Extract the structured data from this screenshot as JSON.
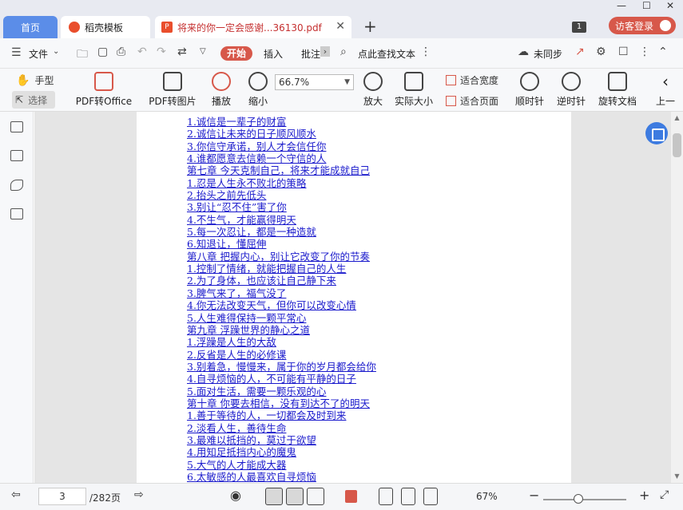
{
  "tabs": {
    "home": "首页",
    "wps": "稻壳模板",
    "pdf": "将来的你一定会感谢...36130.pdf"
  },
  "titlebar": {
    "window_count": "1",
    "login": "访客登录"
  },
  "menu": {
    "file": "文件",
    "start": "开始",
    "insert": "插入",
    "annotate": "批注",
    "search": "点此查找文本",
    "sync": "未同步"
  },
  "ribbon": {
    "hand": "手型",
    "select": "选择",
    "pdf_office": "PDF转Office",
    "pdf_image": "PDF转图片",
    "play": "播放",
    "zoom_out": "缩小",
    "zoom_value": "66.7%",
    "zoom_in": "放大",
    "actual": "实际大小",
    "fit_width": "适合宽度",
    "fit_page": "适合页面",
    "rotate_cw": "顺时针",
    "rotate_ccw": "逆时针",
    "rotate_doc": "旋转文档",
    "prev": "上一"
  },
  "document": {
    "lines": [
      "1.诚信是一辈子的财富",
      "2.诚信让未来的日子顺风顺水",
      "3.你信守承诺，别人才会信任你",
      "4.谁都愿意去信赖一个守信的人",
      "第七章 今天克制自己，将来才能成就自己",
      "1.忍是人生永不败北的策略",
      "2.抬头之前先低头",
      "3.别让“忍不住”害了你",
      "4.不生气，才能赢得明天",
      "5.每一次忍让，都是一种造就",
      "6.知退让，懂屈伸",
      "第八章 把握内心，别让它改变了你的节奏",
      "1.控制了情绪，就能把握自己的人生",
      "2.为了身体，也应该让自己静下来",
      "3.脾气来了，福气没了",
      "4.你无法改变天气，但你可以改变心情",
      "5.人生难得保持一颗平常心",
      "第九章 浮躁世界的静心之道",
      "1.浮躁是人生的大敌",
      "2.反省是人生的必修课",
      "3.别着急，慢慢来，属于你的岁月都会给你",
      "4.自寻烦恼的人，不可能有平静的日子",
      "5.面对生活，需要一颗乐观的心",
      "第十章 你要去相信，没有到达不了的明天",
      "1.善于等待的人，一切都会及时到来",
      "2.淡看人生，善待生命",
      "3.最难以抵挡的，莫过于欲望",
      "4.用知足抵挡内心的魔鬼",
      "5.大气的人才能成大器",
      "6.太敏感的人最喜欢自寻烦恼"
    ]
  },
  "status": {
    "page": "3",
    "total": "/282页",
    "zoom": "67%",
    "zoom_level": 0.42
  }
}
